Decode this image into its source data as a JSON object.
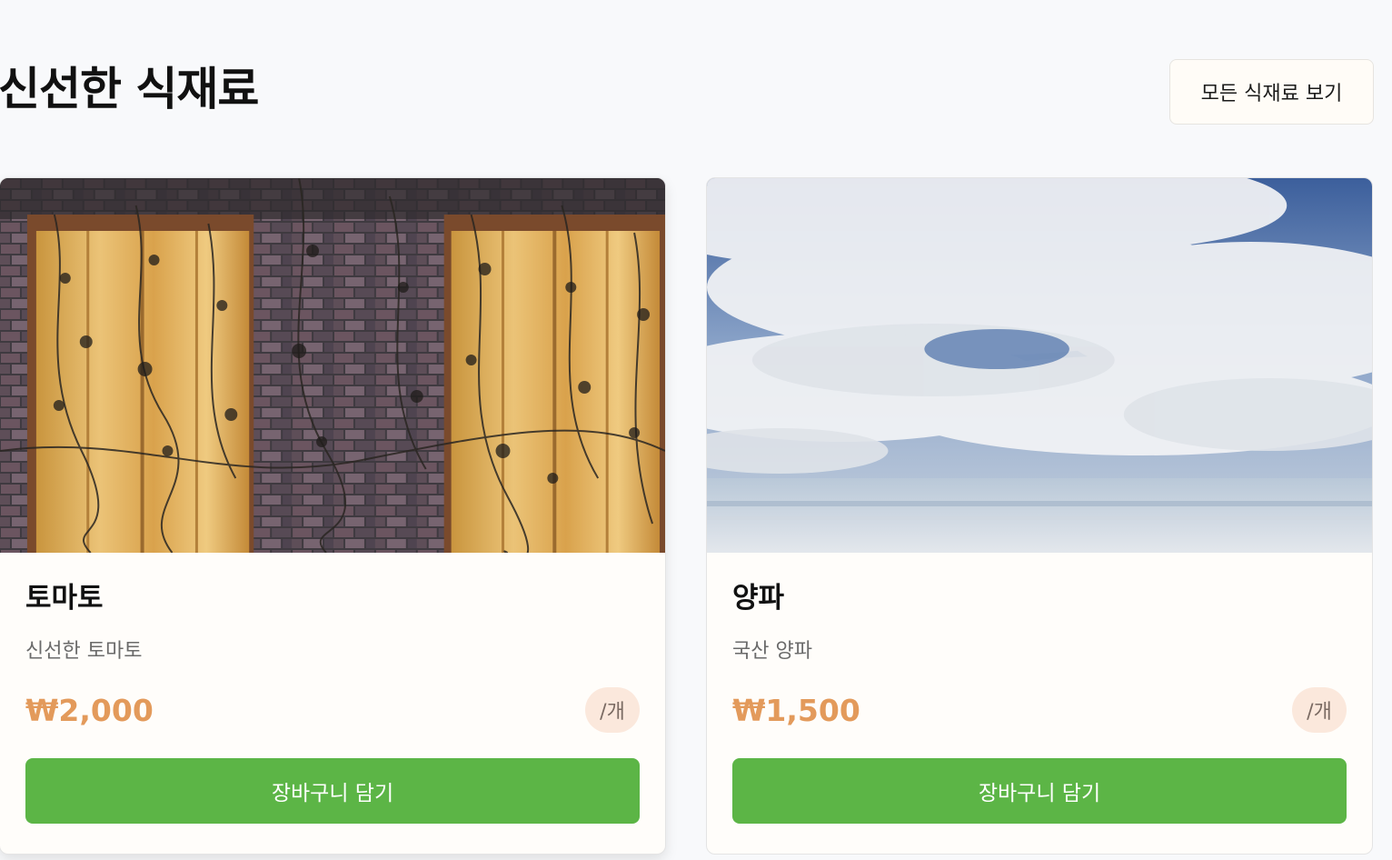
{
  "section": {
    "title": "신선한 식재료",
    "view_all_label": "모든 식재료 보기"
  },
  "products": [
    {
      "name": "토마토",
      "description": "신선한 토마토",
      "price": "₩2,000",
      "unit": "/개",
      "cart_label": "장바구니 담기",
      "image": "brick-wall-wooden-doors-vines"
    },
    {
      "name": "양파",
      "description": "국산 양파",
      "price": "₩1,500",
      "unit": "/개",
      "cart_label": "장바구니 담기",
      "image": "cloudy-sky-reflection"
    }
  ],
  "colors": {
    "accent_green": "#5cb546",
    "price_orange": "#e39a5b",
    "badge_bg": "#fbe8dc"
  }
}
